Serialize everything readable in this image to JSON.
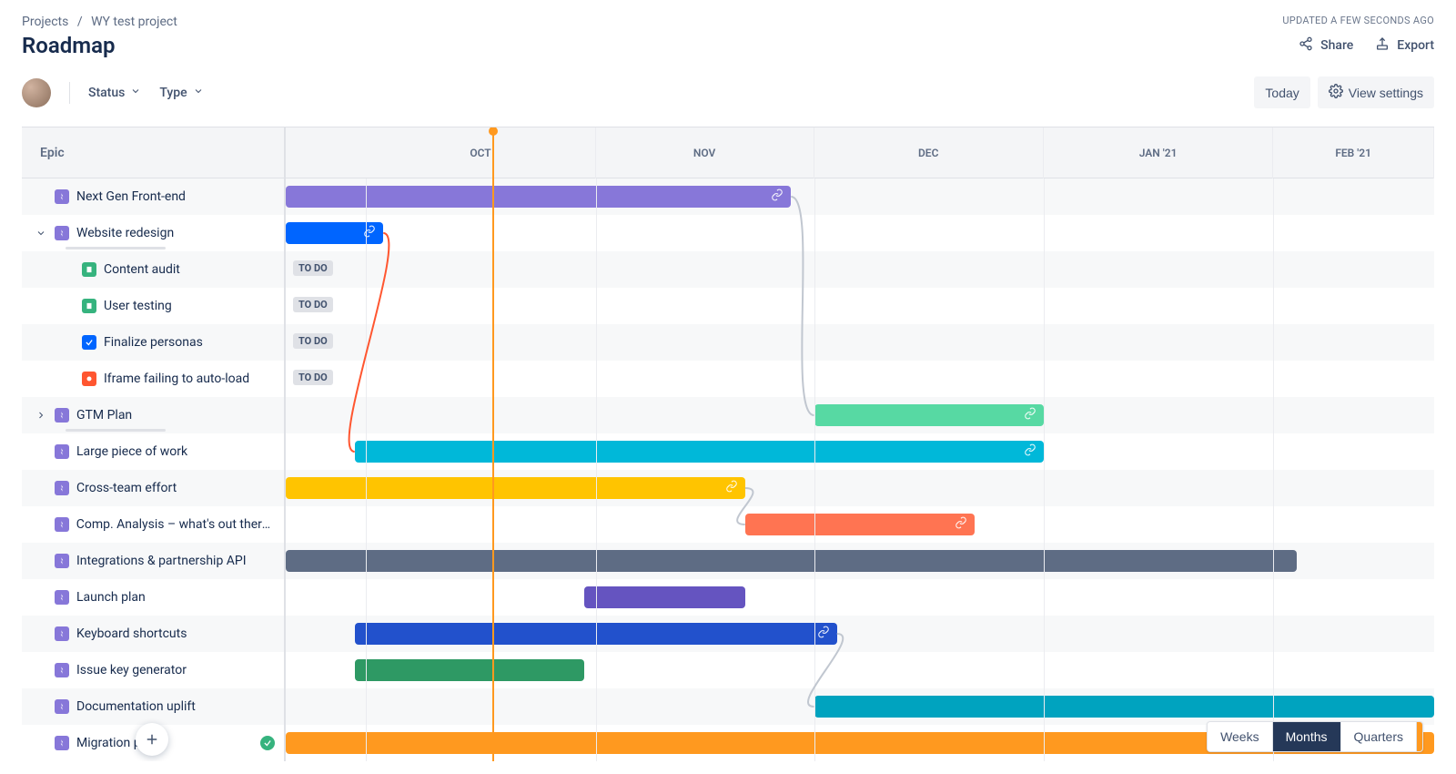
{
  "breadcrumb": {
    "root": "Projects",
    "project": "WY test project"
  },
  "page_title": "Roadmap",
  "updated_text": "UPDATED A FEW SECONDS AGO",
  "actions": {
    "share": "Share",
    "export": "Export"
  },
  "filters": {
    "status": "Status",
    "type": "Type"
  },
  "toolbar": {
    "today": "Today",
    "view_settings": "View settings"
  },
  "sidebar_header": "Epic",
  "months": [
    "OCT",
    "NOV",
    "DEC",
    "JAN '21",
    "FEB '21"
  ],
  "rows": {
    "next_gen": "Next Gen Front-end",
    "website_redesign": "Website redesign",
    "content_audit": "Content audit",
    "user_testing": "User testing",
    "finalize_personas": "Finalize personas",
    "iframe_bug": "Iframe failing to auto-load",
    "gtm_plan": "GTM Plan",
    "large_piece": "Large piece of work",
    "cross_team": "Cross-team effort",
    "comp_analysis": "Comp. Analysis – what's out there?",
    "integrations": "Integrations & partnership API",
    "launch_plan": "Launch plan",
    "keyboard_shortcuts": "Keyboard shortcuts",
    "issue_key_gen": "Issue key generator",
    "doc_uplift": "Documentation uplift",
    "migration": "Migration pla"
  },
  "status_label": "TO DO",
  "colors": {
    "purple": "#8777D9",
    "blue": "#0065FF",
    "teal": "#00B8D9",
    "mint": "#57D9A3",
    "orange": "#FF991F",
    "coral": "#FF7452",
    "navy": "#2251CC",
    "darkgreen": "#2E9964",
    "slate": "#5E6C84",
    "darkpurple": "#6554C0",
    "cyan": "#00A3BF"
  },
  "view_switcher": {
    "weeks": "Weeks",
    "months": "Months",
    "quarters": "Quarters"
  }
}
